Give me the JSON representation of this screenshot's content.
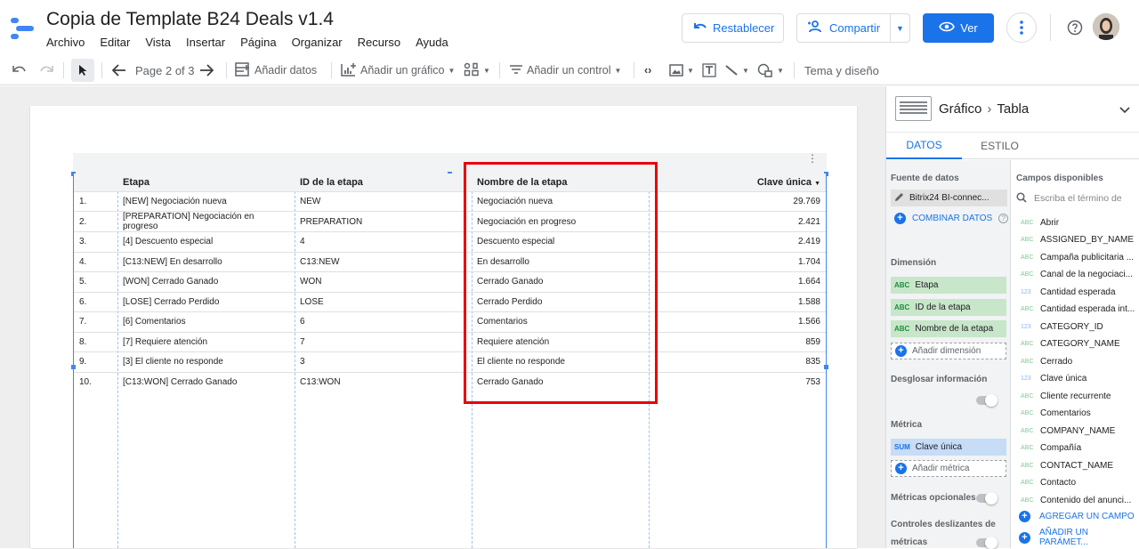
{
  "app": {
    "title": "Copia de Template B24 Deals v1.4",
    "menu": [
      "Archivo",
      "Editar",
      "Vista",
      "Insertar",
      "Página",
      "Organizar",
      "Recurso",
      "Ayuda"
    ],
    "restablecer_label": "Restablecer",
    "compartir_label": "Compartir",
    "ver_label": "Ver"
  },
  "toolbar": {
    "page_label": "Page 2 of 3",
    "add_data_label": "Añadir datos",
    "add_chart_label": "Añadir un gráfico",
    "add_control_label": "Añadir un control",
    "theme_label": "Tema y diseño"
  },
  "table": {
    "headers": [
      "Etapa",
      "ID de la etapa",
      "Nombre de la etapa",
      "Clave única"
    ],
    "rows": [
      {
        "n": "1.",
        "etapa": "[NEW] Negociación nueva",
        "id": "NEW",
        "nombre": "Negociación nueva",
        "clave": "29.769"
      },
      {
        "n": "2.",
        "etapa": "[PREPARATION] Negociación en progreso",
        "id": "PREPARATION",
        "nombre": "Negociación en progreso",
        "clave": "2.421"
      },
      {
        "n": "3.",
        "etapa": "[4] Descuento especial",
        "id": "4",
        "nombre": "Descuento especial",
        "clave": "2.419"
      },
      {
        "n": "4.",
        "etapa": "[C13:NEW] En desarrollo",
        "id": "C13:NEW",
        "nombre": "En desarrollo",
        "clave": "1.704"
      },
      {
        "n": "5.",
        "etapa": "[WON] Cerrado Ganado",
        "id": "WON",
        "nombre": "Cerrado Ganado",
        "clave": "1.664"
      },
      {
        "n": "6.",
        "etapa": "[LOSE] Cerrado Perdido",
        "id": "LOSE",
        "nombre": "Cerrado Perdido",
        "clave": "1.588"
      },
      {
        "n": "7.",
        "etapa": "[6] Comentarios",
        "id": "6",
        "nombre": "Comentarios",
        "clave": "1.566"
      },
      {
        "n": "8.",
        "etapa": "[7] Requiere atención",
        "id": "7",
        "nombre": "Requiere atención",
        "clave": "859"
      },
      {
        "n": "9.",
        "etapa": "[3] El cliente no responde",
        "id": "3",
        "nombre": "El cliente no responde",
        "clave": "835"
      },
      {
        "n": "10.",
        "etapa": "[C13:WON] Cerrado Ganado",
        "id": "C13:WON",
        "nombre": "Cerrado Ganado",
        "clave": "753"
      }
    ]
  },
  "panel": {
    "breadcrumb_parent": "Gráfico",
    "breadcrumb_child": "Tabla",
    "tab_datos": "DATOS",
    "tab_estilo": "ESTILO",
    "fuente_label": "Fuente de datos",
    "fuente_name": "Bitrix24 BI-connec...",
    "combinar_label": "COMBINAR DATOS",
    "dimension_label": "Dimensión",
    "dimensions": [
      "Etapa",
      "ID de la etapa",
      "Nombre de la etapa"
    ],
    "dim_tag": "ABC",
    "add_dimension": "Añadir dimensión",
    "desglosar_label": "Desglosar información",
    "metrica_label": "Métrica",
    "metric_tag": "SUM",
    "metric": "Clave única",
    "add_metric": "Añadir métrica",
    "opcionales_label": "Métricas opcionales",
    "controles_label_1": "Controles deslizantes de",
    "controles_label_2": "métricas",
    "campos_label": "Campos disponibles",
    "search_placeholder": "Escriba el término de",
    "fields": [
      {
        "type": "ABC",
        "name": "Abrir"
      },
      {
        "type": "ABC",
        "name": "ASSIGNED_BY_NAME"
      },
      {
        "type": "ABC",
        "name": "Campaña publicitaria ..."
      },
      {
        "type": "ABC",
        "name": "Canal de la negociaci..."
      },
      {
        "type": "123",
        "name": "Cantidad esperada"
      },
      {
        "type": "ABC",
        "name": "Cantidad esperada int..."
      },
      {
        "type": "123",
        "name": "CATEGORY_ID"
      },
      {
        "type": "ABC",
        "name": "CATEGORY_NAME"
      },
      {
        "type": "ABC",
        "name": "Cerrado"
      },
      {
        "type": "123",
        "name": "Clave única"
      },
      {
        "type": "ABC",
        "name": "Cliente recurrente"
      },
      {
        "type": "ABC",
        "name": "Comentarios"
      },
      {
        "type": "ABC",
        "name": "COMPANY_NAME"
      },
      {
        "type": "ABC",
        "name": "Compañía"
      },
      {
        "type": "ABC",
        "name": "CONTACT_NAME"
      },
      {
        "type": "ABC",
        "name": "Contacto"
      },
      {
        "type": "ABC",
        "name": "Contenido del anunci..."
      }
    ],
    "agregar_campo": "AGREGAR UN CAMPO",
    "anadir_parametro": "AÑADIR UN PARÁMET..."
  }
}
